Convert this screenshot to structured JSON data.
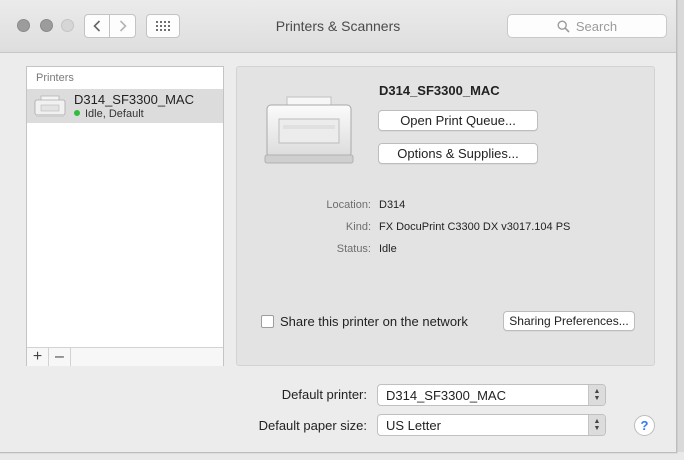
{
  "window": {
    "title": "Printers & Scanners"
  },
  "toolbar": {
    "search_placeholder": "Search"
  },
  "printers_list": {
    "header": "Printers",
    "items": [
      {
        "name": "D314_SF3300_MAC",
        "status": "Idle, Default",
        "status_color": "#2fbd3c"
      }
    ],
    "add_label": "+",
    "remove_label": "–"
  },
  "detail": {
    "name": "D314_SF3300_MAC",
    "open_queue_label": "Open Print Queue...",
    "options_label": "Options & Supplies...",
    "location_label": "Location:",
    "location_value": "D314",
    "kind_label": "Kind:",
    "kind_value": "FX DocuPrint C3300 DX v3017.104 PS",
    "status_label": "Status:",
    "status_value": "Idle",
    "share_label": "Share this printer on the network",
    "share_checked": false,
    "sharing_prefs_label": "Sharing Preferences..."
  },
  "defaults": {
    "default_printer_label": "Default printer:",
    "default_printer_value": "D314_SF3300_MAC",
    "paper_size_label": "Default paper size:",
    "paper_size_value": "US Letter"
  },
  "help_label": "?"
}
